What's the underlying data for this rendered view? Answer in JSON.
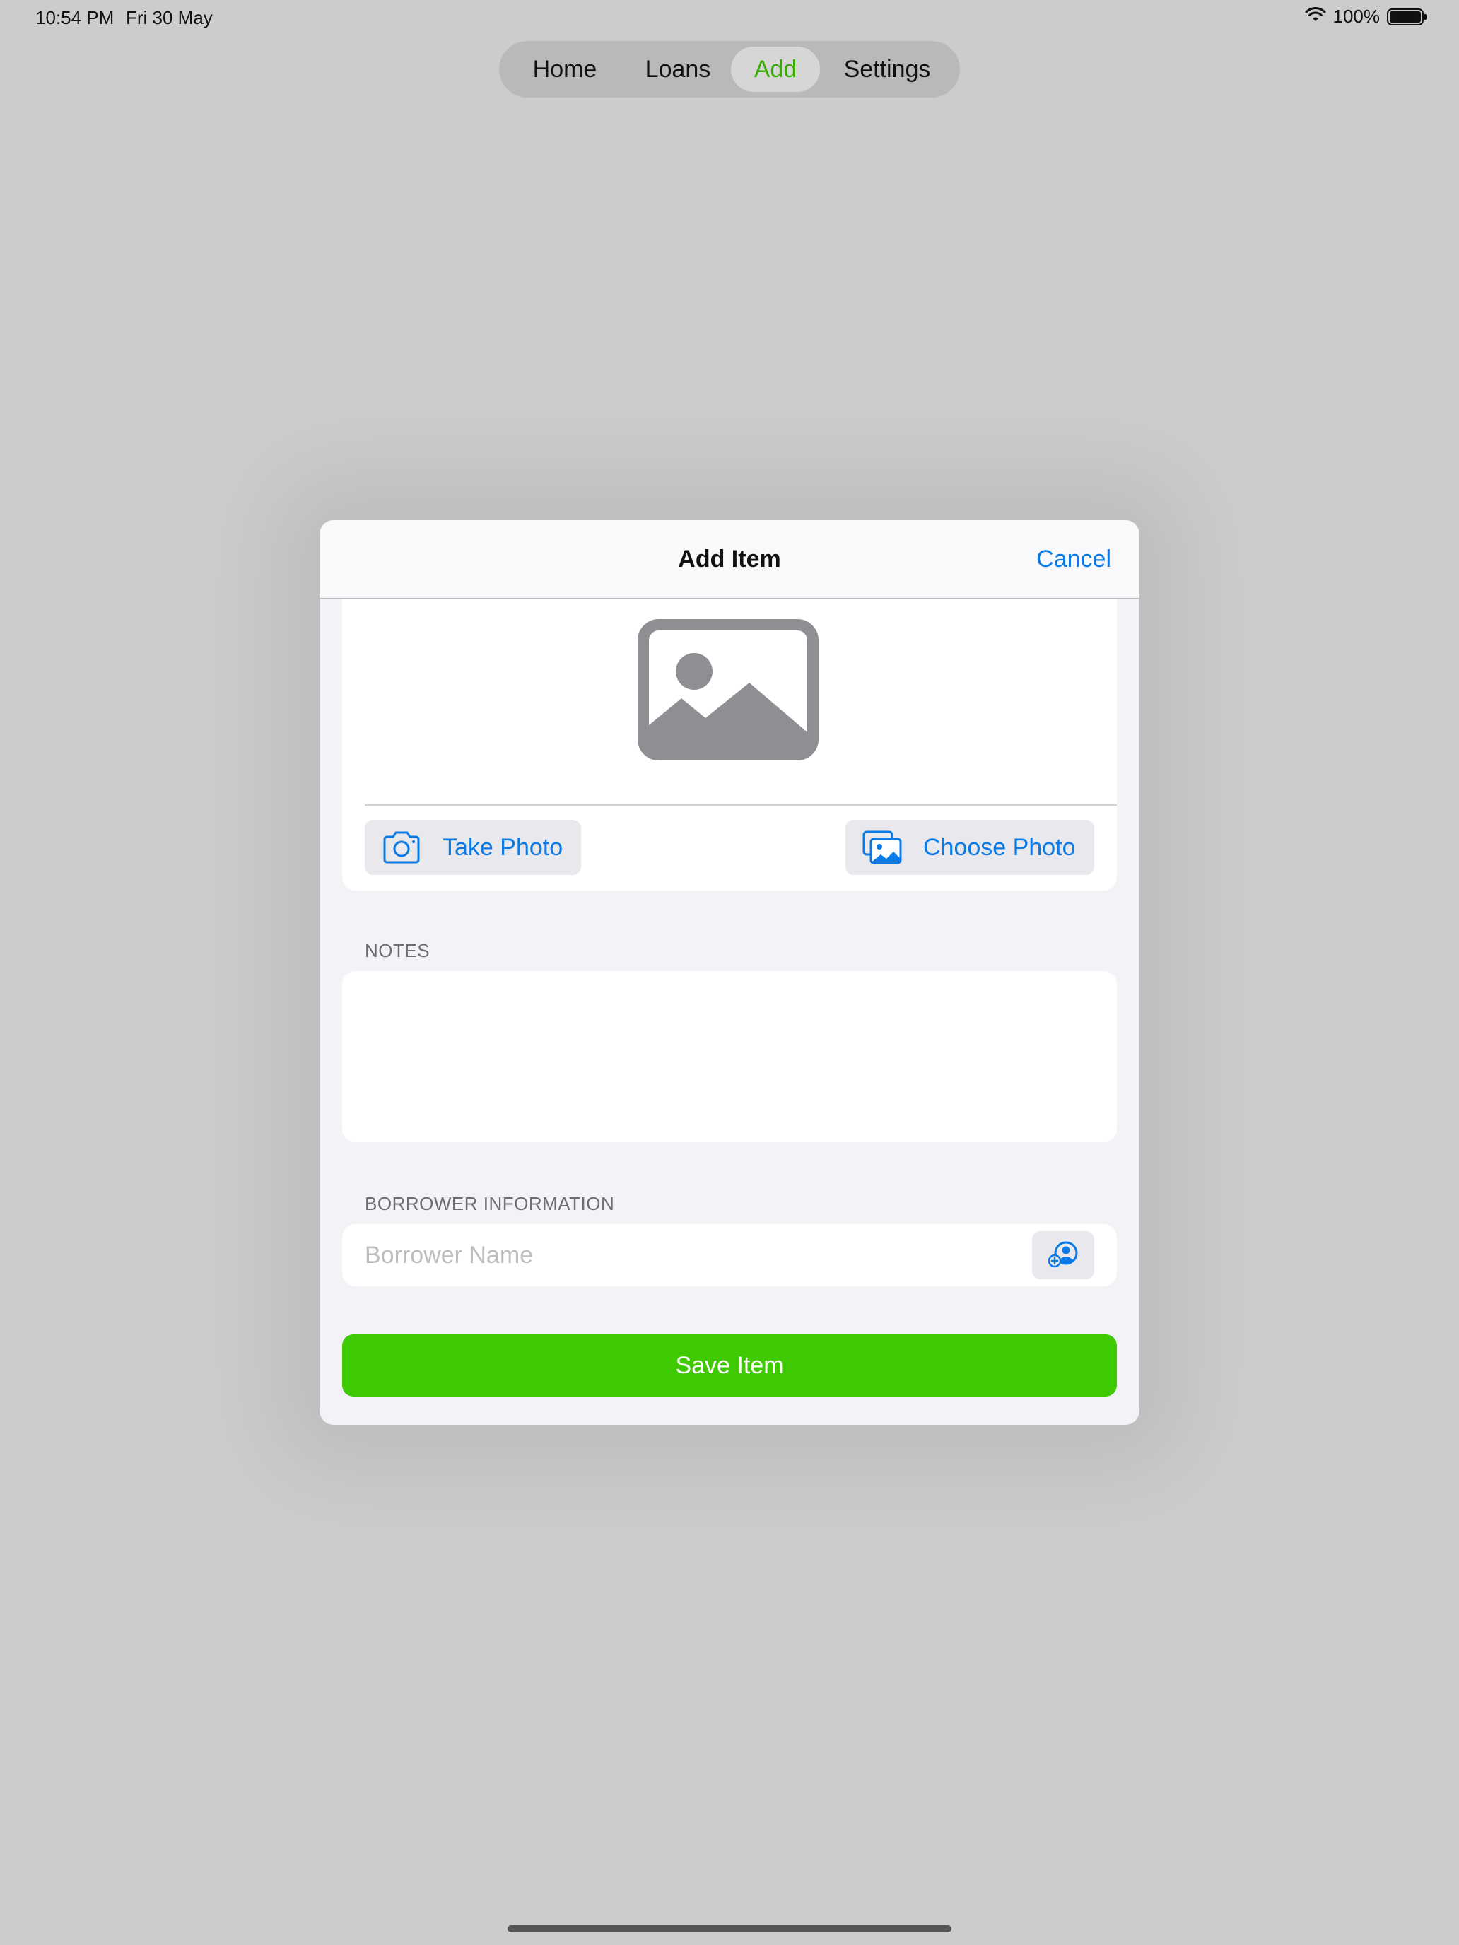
{
  "status_bar": {
    "time": "10:54 PM",
    "date": "Fri 30 May",
    "battery": "100%",
    "icons": [
      "wifi-icon",
      "battery-icon"
    ]
  },
  "tabs": [
    {
      "label": "Home",
      "selected": false
    },
    {
      "label": "Loans",
      "selected": false
    },
    {
      "label": "Add",
      "selected": true
    },
    {
      "label": "Settings",
      "selected": false
    }
  ],
  "modal": {
    "title": "Add Item",
    "cancel_label": "Cancel",
    "photo": {
      "placeholder_icon": "photo-placeholder-icon",
      "take_photo_label": "Take Photo",
      "choose_photo_label": "Choose Photo"
    },
    "notes": {
      "header": "NOTES",
      "value": ""
    },
    "borrower": {
      "header": "BORROWER INFORMATION",
      "name_placeholder": "Borrower Name",
      "name_value": ""
    },
    "save_label": "Save Item"
  },
  "colors": {
    "accent_blue": "#0a7ae6",
    "selected_tab_green": "#3aab05",
    "save_green": "#3ec903",
    "dim_background": "#cccccc"
  }
}
